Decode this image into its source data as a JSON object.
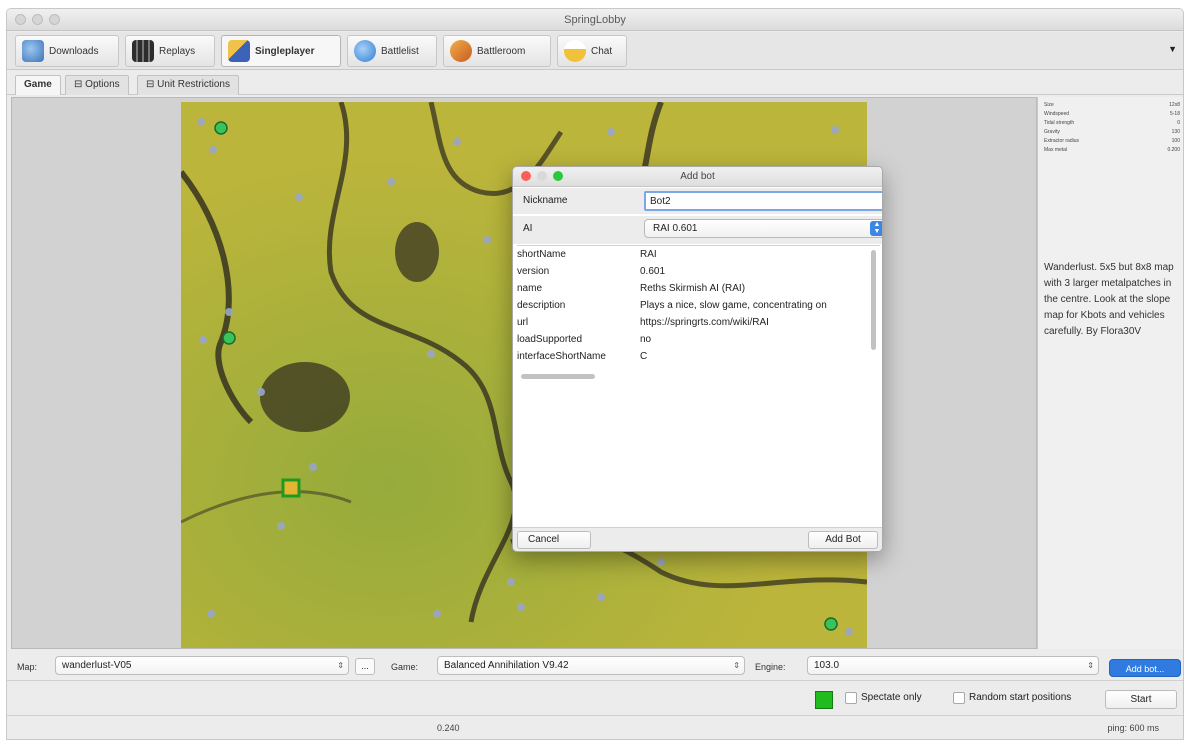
{
  "window": {
    "title": "SpringLobby"
  },
  "toolbar": {
    "items": [
      {
        "label": "Downloads",
        "icon": "downloads-icon",
        "color": "#4f86c9"
      },
      {
        "label": "Replays",
        "icon": "replays-icon",
        "color": "#3a3a3a"
      },
      {
        "label": "Singleplayer",
        "icon": "singleplayer-icon",
        "color": "#3d63b8",
        "active": true
      },
      {
        "label": "Battlelist",
        "icon": "battlelist-icon",
        "color": "#2f7ed7"
      },
      {
        "label": "Battleroom",
        "icon": "battleroom-icon",
        "color": "#d9862b"
      },
      {
        "label": "Chat",
        "icon": "chat-icon",
        "color": "#e2b43a"
      }
    ],
    "menu_glyph": "▼"
  },
  "subtabs": [
    {
      "label": "Game",
      "active": true
    },
    {
      "label": "Options",
      "active": false
    },
    {
      "label": "Unit Restrictions",
      "active": false
    }
  ],
  "map_stats": [
    {
      "key": "Size",
      "value": "12x8"
    },
    {
      "key": "Windspeed",
      "value": "5-18"
    },
    {
      "key": "Tidal strength",
      "value": "0"
    },
    {
      "key": "Gravity",
      "value": "130"
    },
    {
      "key": "Extractor radius",
      "value": "100"
    },
    {
      "key": "Max metal",
      "value": "0.200"
    }
  ],
  "map_description": "Wanderlust. 5x5 but 8x8 map with 3 larger metalpatches in the centre. Look at the slope map for Kbots and vehicles carefully. By Flora30V",
  "add_bot_dialog": {
    "title": "Add bot",
    "nickname_label": "Nickname",
    "nickname_value": "Bot2",
    "ai_label": "AI",
    "ai_value": "RAI 0.601",
    "properties": [
      {
        "key": "shortName",
        "value": "RAI"
      },
      {
        "key": "version",
        "value": "0.601"
      },
      {
        "key": "name",
        "value": "Reths Skirmish AI (RAI)"
      },
      {
        "key": "description",
        "value": "Plays a nice, slow game, concentrating on"
      },
      {
        "key": "url",
        "value": "https://springrts.com/wiki/RAI"
      },
      {
        "key": "loadSupported",
        "value": "no"
      },
      {
        "key": "interfaceShortName",
        "value": "C"
      }
    ],
    "cancel_label": "Cancel",
    "add_label": "Add Bot"
  },
  "bottom": {
    "map_label": "Map:",
    "map_value": "wanderlust-V05",
    "map_browse": "...",
    "game_label": "Game:",
    "game_value": "Balanced Annihilation V9.42",
    "engine_label": "Engine:",
    "engine_value": "103.0",
    "add_bot_label": "Add bot...",
    "spectate_label": "Spectate only",
    "random_start_label": "Random start positions",
    "start_label": "Start",
    "player_color": "#22bb1e"
  },
  "status": {
    "center": "0.240",
    "right": "ping: 600 ms"
  }
}
